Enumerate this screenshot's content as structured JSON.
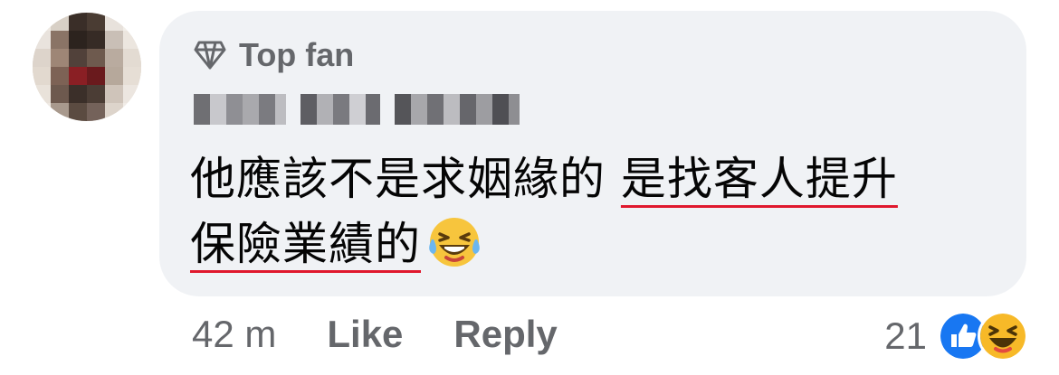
{
  "comment": {
    "badge_label": "Top fan",
    "text_part1": "他應該不是求姻緣的 ",
    "text_underlined_1": "是找客人提升",
    "text_underlined_2": "保險業績的",
    "emoji": "laughing-with-tears-emoji"
  },
  "footer": {
    "time": "42 m",
    "like_label": "Like",
    "reply_label": "Reply"
  },
  "reactions": {
    "count": "21",
    "icons": [
      "like-icon",
      "haha-icon"
    ],
    "like_color": "#1877f2",
    "haha_color": "#f7b928"
  },
  "colors": {
    "bubble_bg": "#f0f2f5",
    "meta_text": "#65676b",
    "underline": "#e0182d"
  }
}
